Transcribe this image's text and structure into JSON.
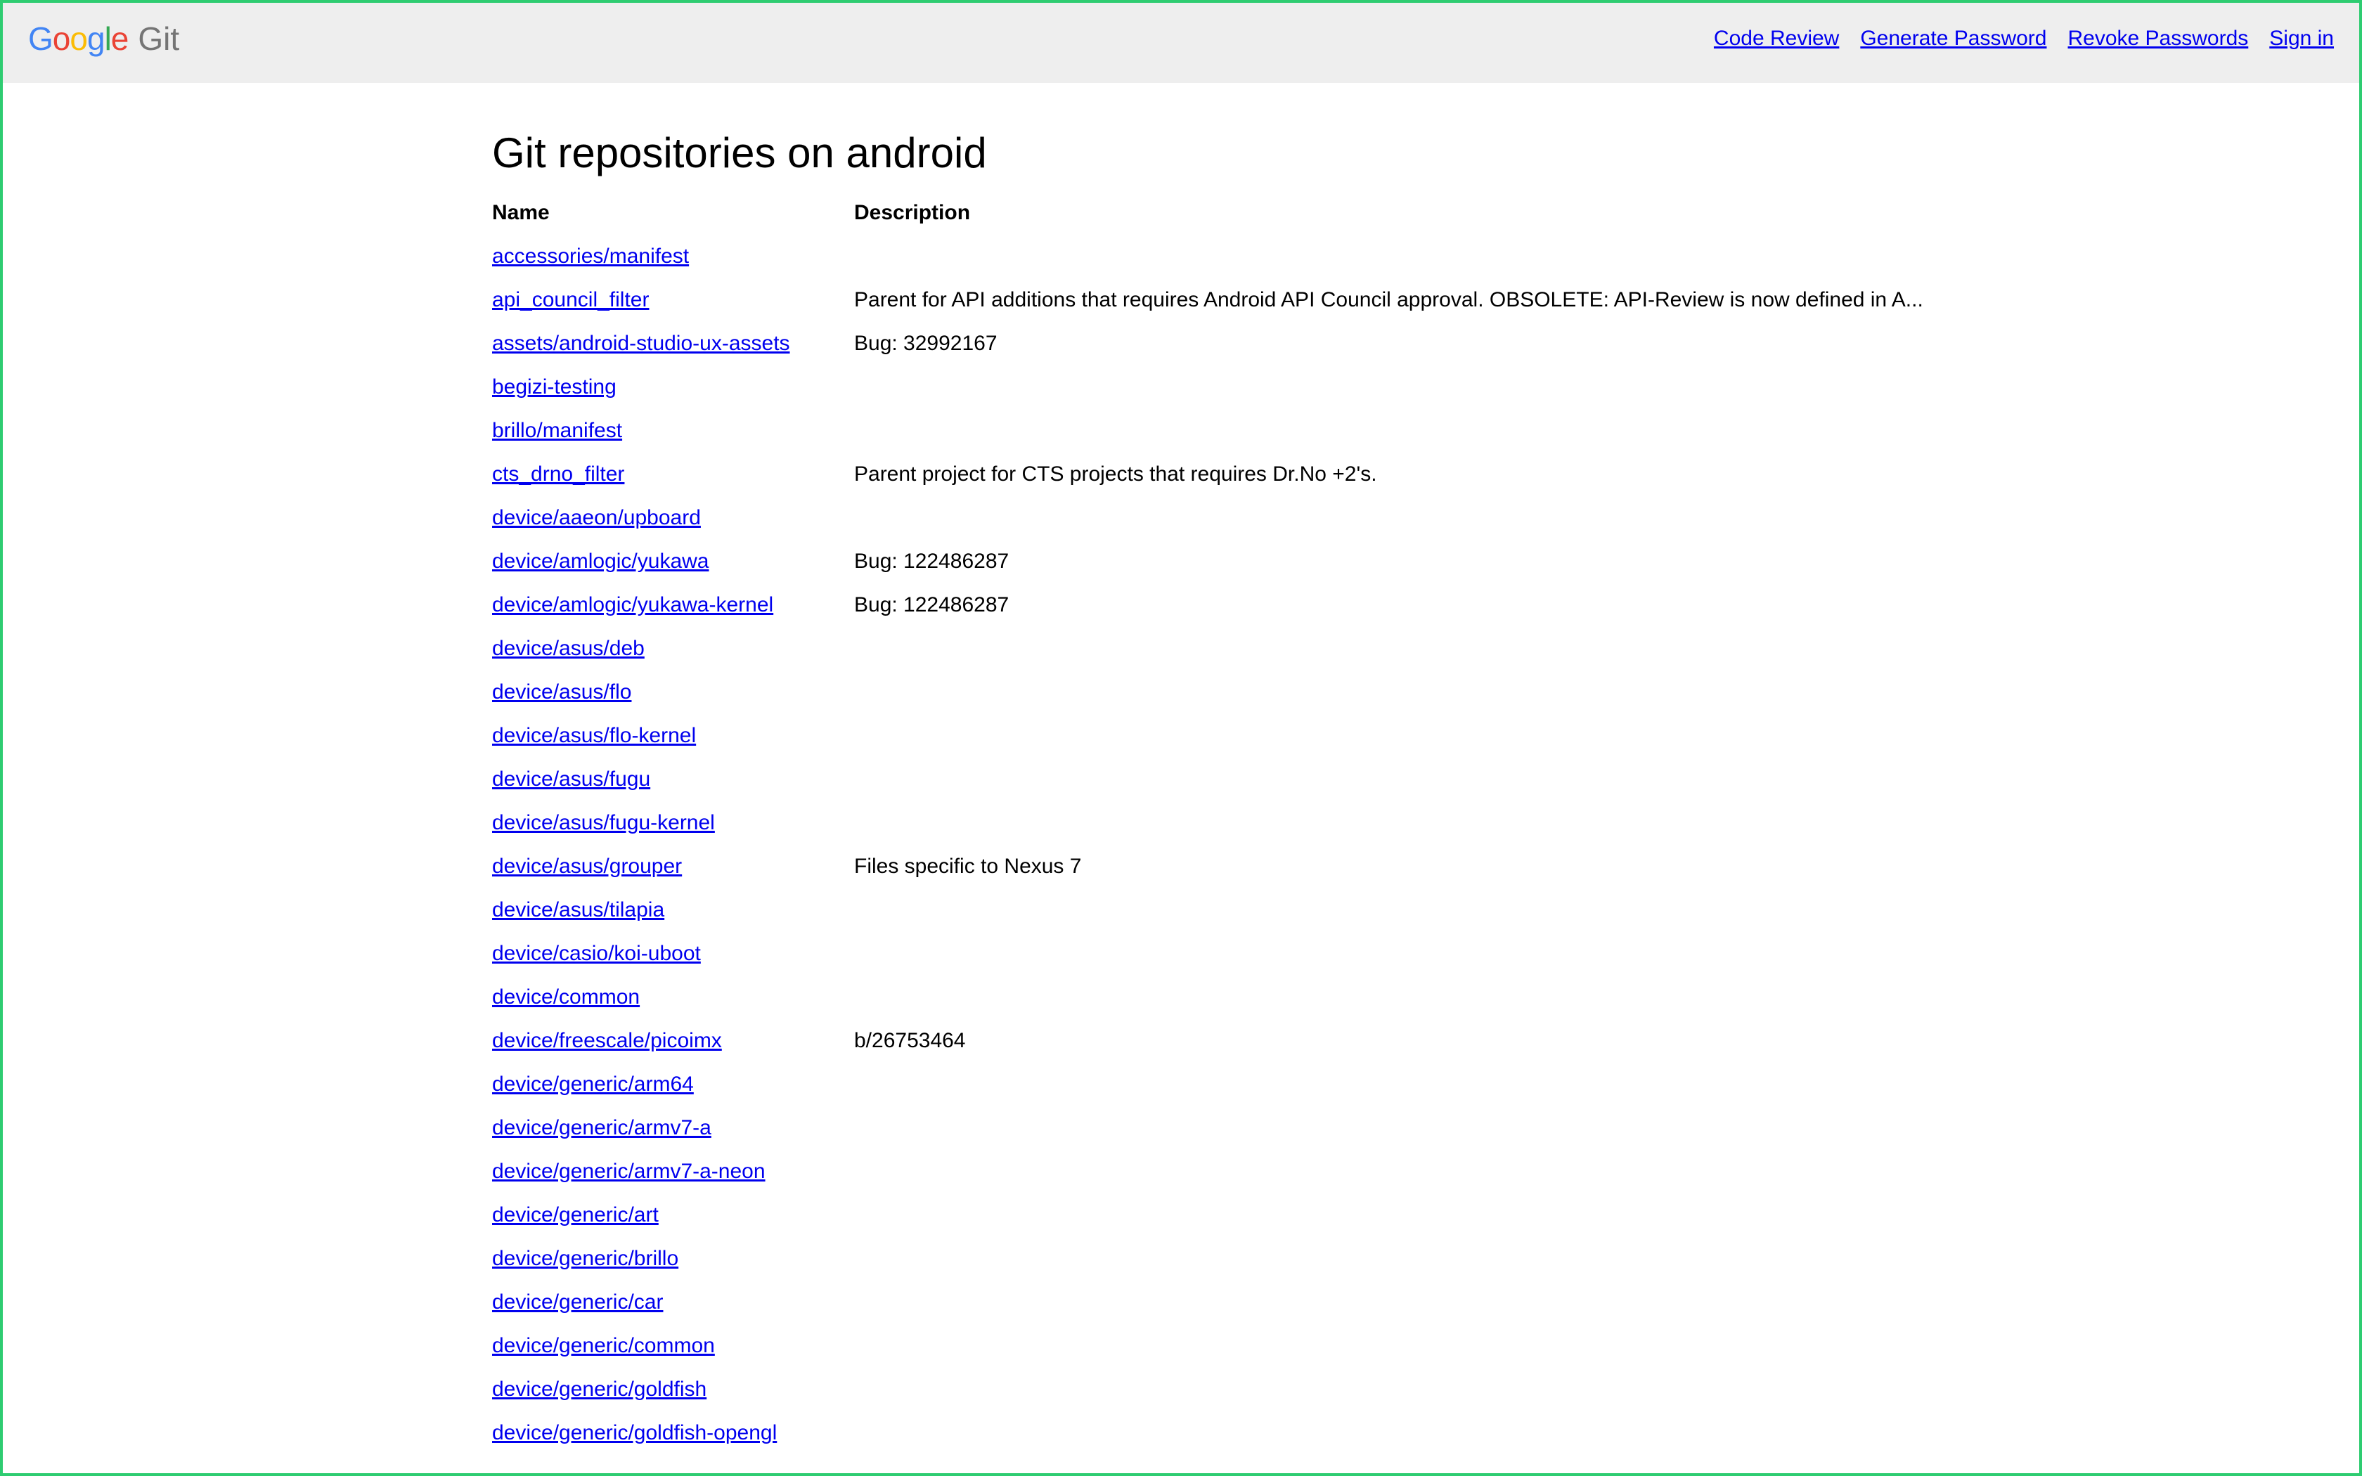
{
  "header": {
    "logo": {
      "letters": [
        "G",
        "o",
        "o",
        "g",
        "l",
        "e"
      ],
      "product": "Git"
    },
    "nav": [
      {
        "label": "Code Review",
        "name": "code-review-link"
      },
      {
        "label": "Generate Password",
        "name": "generate-password-link"
      },
      {
        "label": "Revoke Passwords",
        "name": "revoke-passwords-link"
      },
      {
        "label": "Sign in",
        "name": "sign-in-link"
      }
    ]
  },
  "main": {
    "title": "Git repositories on android",
    "columns": {
      "name": "Name",
      "description": "Description"
    },
    "repos": [
      {
        "name": "accessories/manifest",
        "description": ""
      },
      {
        "name": "api_council_filter",
        "description": "Parent for API additions that requires Android API Council approval. OBSOLETE: API-Review is now defined in A..."
      },
      {
        "name": "assets/android-studio-ux-assets",
        "description": "Bug: 32992167"
      },
      {
        "name": "begizi-testing",
        "description": ""
      },
      {
        "name": "brillo/manifest",
        "description": ""
      },
      {
        "name": "cts_drno_filter",
        "description": "Parent project for CTS projects that requires Dr.No +2's."
      },
      {
        "name": "device/aaeon/upboard",
        "description": ""
      },
      {
        "name": "device/amlogic/yukawa",
        "description": "Bug: 122486287"
      },
      {
        "name": "device/amlogic/yukawa-kernel",
        "description": "Bug: 122486287"
      },
      {
        "name": "device/asus/deb",
        "description": ""
      },
      {
        "name": "device/asus/flo",
        "description": ""
      },
      {
        "name": "device/asus/flo-kernel",
        "description": ""
      },
      {
        "name": "device/asus/fugu",
        "description": ""
      },
      {
        "name": "device/asus/fugu-kernel",
        "description": ""
      },
      {
        "name": "device/asus/grouper",
        "description": "Files specific to Nexus 7"
      },
      {
        "name": "device/asus/tilapia",
        "description": ""
      },
      {
        "name": "device/casio/koi-uboot",
        "description": ""
      },
      {
        "name": "device/common",
        "description": ""
      },
      {
        "name": "device/freescale/picoimx",
        "description": "b/26753464"
      },
      {
        "name": "device/generic/arm64",
        "description": ""
      },
      {
        "name": "device/generic/armv7-a",
        "description": ""
      },
      {
        "name": "device/generic/armv7-a-neon",
        "description": ""
      },
      {
        "name": "device/generic/art",
        "description": ""
      },
      {
        "name": "device/generic/brillo",
        "description": ""
      },
      {
        "name": "device/generic/car",
        "description": ""
      },
      {
        "name": "device/generic/common",
        "description": ""
      },
      {
        "name": "device/generic/goldfish",
        "description": ""
      },
      {
        "name": "device/generic/goldfish-opengl",
        "description": ""
      }
    ]
  }
}
